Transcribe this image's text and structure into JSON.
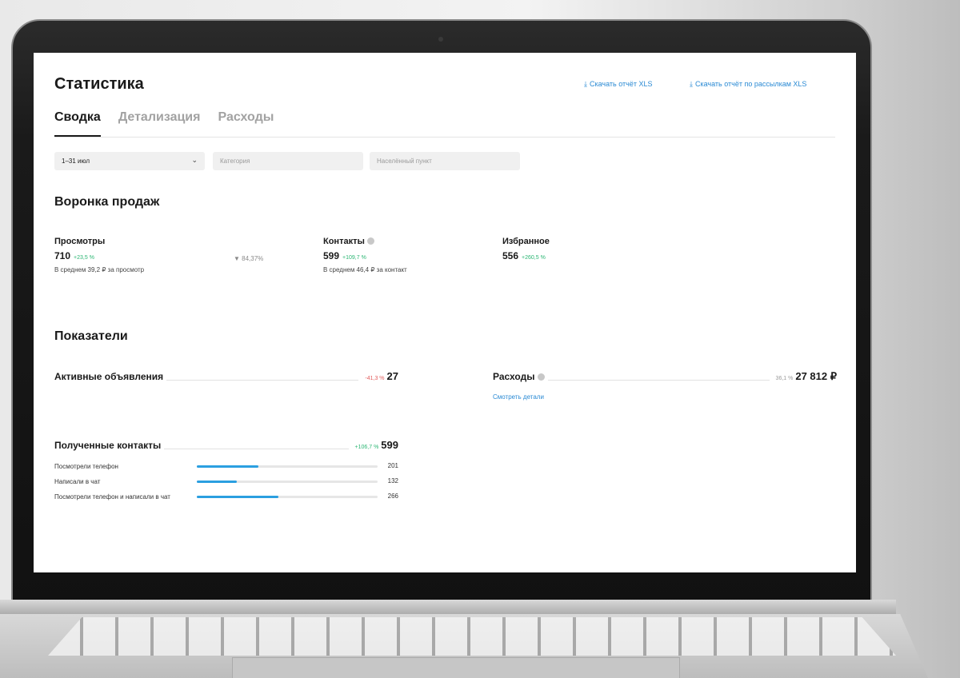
{
  "page": {
    "title": "Статистика",
    "download_report": "Скачать отчёт XLS",
    "download_mailing_report": "Скачать отчёт по рассылкам XLS",
    "download_icon": "download-icon"
  },
  "tabs": [
    {
      "label": "Сводка",
      "active": true
    },
    {
      "label": "Детализация",
      "active": false
    },
    {
      "label": "Расходы",
      "active": false
    }
  ],
  "filters": {
    "period": "1–31 июл",
    "category_placeholder": "Категория",
    "location_placeholder": "Населённый пункт"
  },
  "funnel": {
    "title": "Воронка продаж",
    "views": {
      "label": "Просмотры",
      "value": "710",
      "delta": "+23,5 %",
      "sub": "В среднем 39,2 ₽ за просмотр"
    },
    "conversion": "84,37%",
    "contacts": {
      "label": "Контакты",
      "value": "599",
      "delta": "+109,7 %",
      "sub": "В среднем 46,4 ₽ за контакт"
    },
    "favorites": {
      "label": "Избранное",
      "value": "556",
      "delta": "+260,5 %"
    }
  },
  "metrics": {
    "title": "Показатели",
    "active_ads": {
      "label": "Активные объявления",
      "delta": "-41,3 %",
      "value": "27"
    },
    "expenses": {
      "label": "Расходы",
      "delta": "36,1 %",
      "value": "27 812 ₽",
      "details_link": "Смотреть детали"
    },
    "received_contacts": {
      "label": "Полученные контакты",
      "delta": "+106,7 %",
      "value": "599",
      "rows": [
        {
          "label": "Посмотрели телефон",
          "value": "201",
          "fraction": 0.34
        },
        {
          "label": "Написали в чат",
          "value": "132",
          "fraction": 0.22
        },
        {
          "label": "Посмотрели телефон и написали в чат",
          "value": "266",
          "fraction": 0.45
        }
      ]
    }
  },
  "colors": {
    "accent": "#2a8ad4",
    "bar": "#2b9fe0",
    "positive": "#2bb673",
    "negative": "#e25c5c"
  }
}
